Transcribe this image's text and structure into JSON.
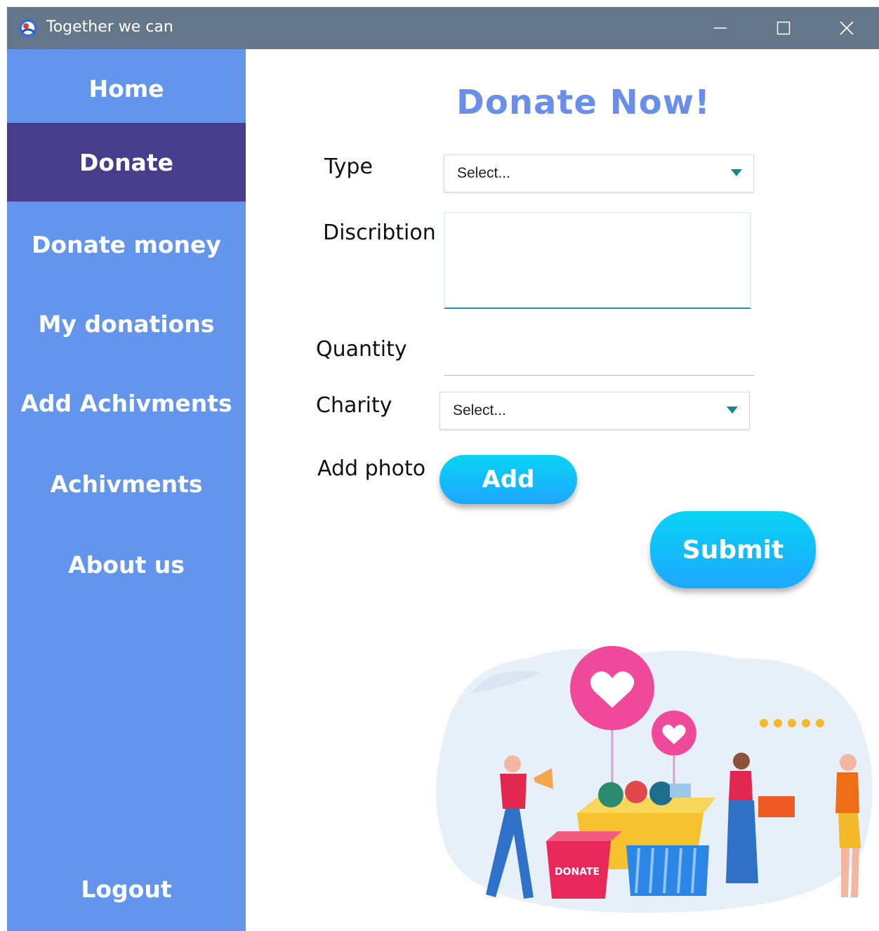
{
  "window": {
    "title": "Together we can"
  },
  "sidebar": {
    "items": [
      {
        "label": "Home",
        "active": false
      },
      {
        "label": "Donate",
        "active": true
      },
      {
        "label": "Donate money",
        "active": false
      },
      {
        "label": "My donations",
        "active": false
      },
      {
        "label": "Add Achivments",
        "active": false
      },
      {
        "label": "Achivments",
        "active": false
      },
      {
        "label": "About us",
        "active": false
      }
    ],
    "logout_label": "Logout"
  },
  "form": {
    "heading": "Donate Now!",
    "type_label": "Type",
    "type_value": "Select...",
    "description_label": "Discribtion",
    "description_value": "",
    "quantity_label": "Quantity",
    "quantity_value": "",
    "charity_label": "Charity",
    "charity_value": "Select...",
    "photo_label": "Add photo",
    "add_button": "Add",
    "submit_button": "Submit"
  },
  "illustration": {
    "box_text": "DONATE"
  },
  "colors": {
    "titlebar": "#64778a",
    "sidebar": "#6495ed",
    "sidebar_active": "#483d8b",
    "heading": "#6a8fe8",
    "button_top": "#08d4f4",
    "button_bottom": "#1ea7ff",
    "dropdown_arrow": "#0d8a8a"
  }
}
